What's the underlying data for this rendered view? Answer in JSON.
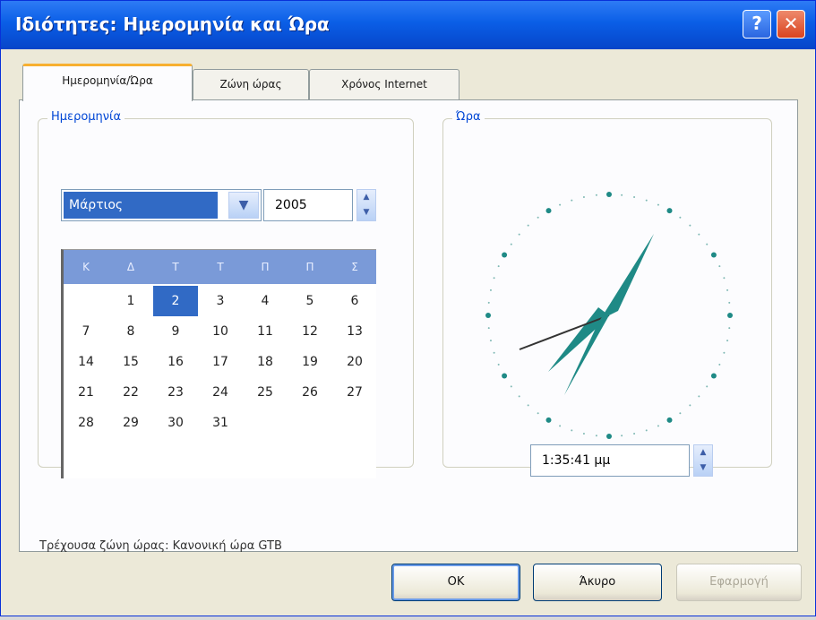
{
  "window": {
    "title": "Ιδιότητες: Ημερομηνία και Ώρα",
    "help_label": "?",
    "close_label": "✕"
  },
  "tabs": [
    {
      "label": "Ημερομηνία/Ώρα",
      "active": true
    },
    {
      "label": "Ζώνη ώρας",
      "active": false
    },
    {
      "label": "Χρόνος Internet",
      "active": false
    }
  ],
  "date_group": {
    "legend": "Ημερομηνία",
    "month": "Μάρτιος",
    "year": "2005",
    "weekday_headers": [
      "Κ",
      "Δ",
      "Τ",
      "Τ",
      "Π",
      "Π",
      "Σ"
    ],
    "selected_day": "2",
    "weeks": [
      [
        "",
        "1",
        "2",
        "3",
        "4",
        "5",
        "6"
      ],
      [
        "7",
        "8",
        "9",
        "10",
        "11",
        "12",
        "13"
      ],
      [
        "14",
        "15",
        "16",
        "17",
        "18",
        "19",
        "20"
      ],
      [
        "21",
        "22",
        "23",
        "24",
        "25",
        "26",
        "27"
      ],
      [
        "28",
        "29",
        "30",
        "31",
        "",
        "",
        ""
      ]
    ]
  },
  "time_group": {
    "legend": "Ώρα",
    "time_value": "1:35:41 μμ"
  },
  "timezone_text": "Τρέχουσα ζώνη ώρας:  Κανονική ώρα GTB",
  "buttons": {
    "ok": "OK",
    "cancel": "Άκυρο",
    "apply": "Εφαρμογή"
  },
  "colors": {
    "titlebar": "#0a5ee6",
    "selection": "#316ac5",
    "calendar_header": "#7a9ad8",
    "clock_hands": "#1f8a86",
    "tab_highlight": "#f7b031"
  }
}
